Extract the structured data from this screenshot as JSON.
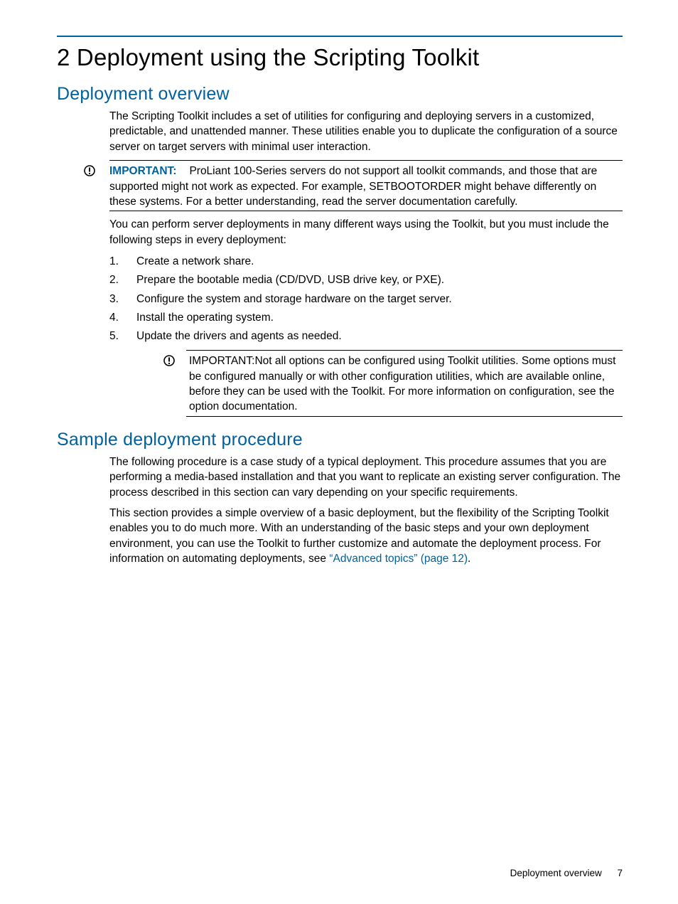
{
  "chapter": {
    "title": "2 Deployment using the Scripting Toolkit"
  },
  "section1": {
    "heading": "Deployment overview",
    "intro": "The Scripting Toolkit includes a set of utilities for configuring and deploying servers in a customized, predictable, and unattended manner. These utilities enable you to duplicate the configuration of a source server on target servers with minimal user interaction.",
    "callout1": {
      "label": "IMPORTANT:",
      "text": "ProLiant 100-Series servers do not support all toolkit commands, and those that are supported might not work as expected. For example, SETBOOTORDER might behave differently on these systems. For a better understanding, read the server documentation carefully."
    },
    "para2": "You can perform server deployments in many different ways using the Toolkit, but you must include the following steps in every deployment:",
    "steps": [
      "Create a network share.",
      "Prepare the bootable media (CD/DVD, USB drive key, or PXE).",
      "Configure the system and storage hardware on the target server.",
      "Install the operating system.",
      "Update the drivers and agents as needed."
    ],
    "callout2": {
      "label": "IMPORTANT:",
      "text": "Not all options can be configured using Toolkit utilities. Some options must be configured manually or with other configuration utilities, which are available online, before they can be used with the Toolkit. For more information on configuration, see the option documentation."
    }
  },
  "section2": {
    "heading": "Sample deployment procedure",
    "para1": "The following procedure is a case study of a typical deployment. This procedure assumes that you are performing a media-based installation and that you want to replicate an existing server configuration. The process described in this section can vary depending on your specific requirements.",
    "para2_a": "This section provides a simple overview of a basic deployment, but the flexibility of the Scripting Toolkit enables you to do much more. With an understanding of the basic steps and your own deployment environment, you can use the Toolkit to further customize and automate the deployment process. For information on automating deployments, see ",
    "para2_link": "“Advanced topics” (page 12)",
    "para2_b": "."
  },
  "footer": {
    "section": "Deployment overview",
    "page": "7"
  }
}
